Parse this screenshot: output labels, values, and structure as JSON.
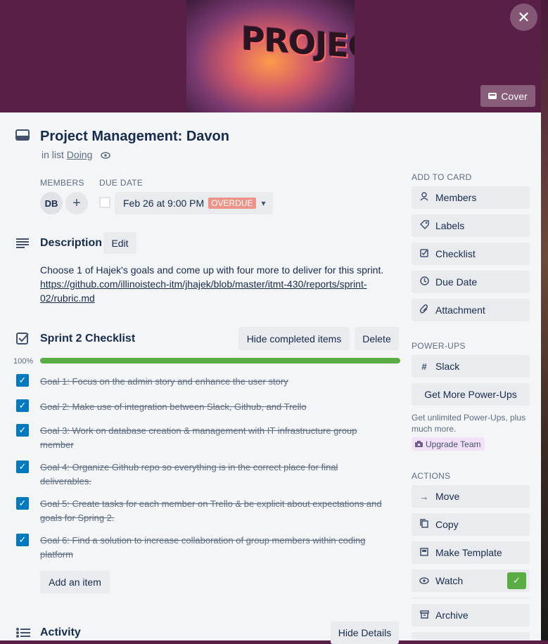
{
  "cover": {
    "text": "PROJECTS",
    "button_label": "Cover"
  },
  "card": {
    "title": "Project Management: Davon",
    "in_list_prefix": "in list",
    "list_name": "Doing"
  },
  "members": {
    "label": "MEMBERS",
    "avatar_initials": "DB"
  },
  "due": {
    "label": "DUE DATE",
    "date": "Feb 26 at 9:00 PM",
    "badge": "OVERDUE"
  },
  "description": {
    "heading": "Description",
    "edit_label": "Edit",
    "text": "Choose 1 of Hajek's goals and come up with four more to deliver for this sprint.",
    "link_line1": "https://github.com/illinoistech-itm/jhajek/blob/master/itmt-430/reports/sprint-",
    "link_line2": "02/rubric.md"
  },
  "checklist": {
    "heading": "Sprint 2 Checklist",
    "hide_label": "Hide completed items",
    "delete_label": "Delete",
    "progress_text": "100%",
    "progress": 1.0,
    "items": [
      "Goal 1: Focus on the admin story and enhance the user story",
      "Goal 2: Make use of integration between Slack, Github, and Trello",
      "Goal 3: Work on database creation & management with IT infrastructure group member",
      "Goal 4: Organize Github repo so everything is in the correct place for final deliverables.",
      "Goal 5: Create tasks for each member on Trello & be explicit about expectations and goals for Spring 2.",
      "Goal 6: Find a solution to increase collaboration of group members within coding platform"
    ],
    "add_item_label": "Add an item"
  },
  "activity": {
    "heading": "Activity",
    "hide_details_label": "Hide Details"
  },
  "sidebar": {
    "add_to_card_heading": "ADD TO CARD",
    "add_to_card": [
      "Members",
      "Labels",
      "Checklist",
      "Due Date",
      "Attachment"
    ],
    "powerups_heading": "POWER-UPS",
    "slack_label": "Slack",
    "get_more_label": "Get More Power-Ups",
    "unlimited_text": "Get unlimited Power-Ups, plus much more.",
    "upgrade_label": "Upgrade Team",
    "actions_heading": "ACTIONS",
    "actions": [
      "Move",
      "Copy",
      "Make Template",
      "Watch",
      "Archive"
    ],
    "colors": {
      "progress_green": "#5aac44",
      "checkbox_blue": "#0079bf",
      "overdue": "#ec9488",
      "upgrade_purple": "#f3e2f7"
    }
  }
}
